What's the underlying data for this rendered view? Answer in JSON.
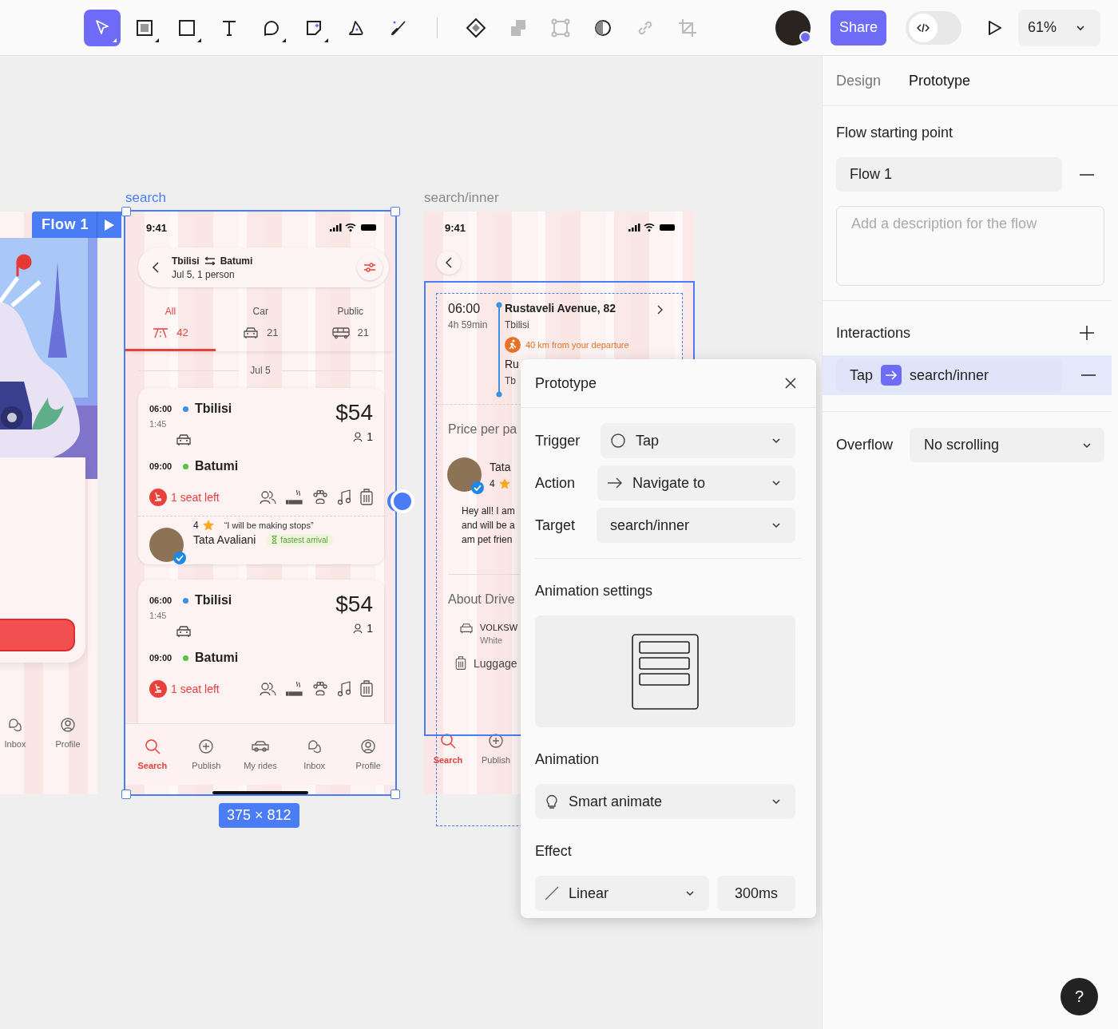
{
  "toolbar": {
    "tools": [
      {
        "kind": "move",
        "selected": true
      },
      {
        "kind": "frame",
        "selected": false
      },
      {
        "kind": "rectangle",
        "selected": false
      },
      {
        "kind": "text",
        "selected": false
      },
      {
        "kind": "comment",
        "selected": false
      },
      {
        "kind": "sticky",
        "selected": false
      },
      {
        "kind": "wizard",
        "selected": false
      },
      {
        "kind": "brush",
        "selected": false
      }
    ],
    "actions": [
      {
        "kind": "component",
        "disabled": false
      },
      {
        "kind": "boolean",
        "disabled": true
      },
      {
        "kind": "corners",
        "disabled": true
      },
      {
        "kind": "mask",
        "disabled": false
      },
      {
        "kind": "link",
        "disabled": true
      },
      {
        "kind": "crop",
        "disabled": true
      }
    ],
    "share": "Share",
    "dev_mode": false,
    "zoom": "61%"
  },
  "canvas": {
    "flow_badge": "Flow 1",
    "side_frame": {
      "nav": [
        {
          "label": "Inbox",
          "kind": "inbox",
          "selected": false
        },
        {
          "label": "Profile",
          "kind": "profile",
          "selected": false
        }
      ]
    },
    "search_frame": {
      "title": "search",
      "selected": true,
      "time": "9:41",
      "from": "Tbilisi",
      "to": "Batumi",
      "subtitle": "Jul 5, 1 person",
      "tabs": [
        {
          "label": "All",
          "count": "42",
          "kind": "all",
          "selected": true
        },
        {
          "label": "Car",
          "count": "21",
          "kind": "car",
          "selected": false
        },
        {
          "label": "Public",
          "count": "21",
          "kind": "bus",
          "selected": false
        }
      ],
      "date": "Jul 5",
      "rides": [
        {
          "dep_time": "06:00",
          "from": "Tbilisi",
          "duration": "1:45",
          "arr_time": "09:00",
          "to": "Batumi",
          "price": "$54",
          "seats": "1",
          "seat_note": "1 seat left",
          "review": {
            "rating": "4",
            "quote": "“I will be making stops”",
            "driver": "Tata Avaliani",
            "tag": "fastest arrival"
          }
        },
        {
          "dep_time": "06:00",
          "from": "Tbilisi",
          "duration": "1:45",
          "arr_time": "09:00",
          "to": "Batumi",
          "price": "$54",
          "seats": "1",
          "seat_note": "1 seat left"
        }
      ],
      "nav": [
        {
          "label": "Search",
          "kind": "search",
          "selected": true
        },
        {
          "label": "Publish",
          "kind": "publish",
          "selected": false
        },
        {
          "label": "My rides",
          "kind": "rides",
          "selected": false
        },
        {
          "label": "Inbox",
          "kind": "inbox",
          "selected": false
        },
        {
          "label": "Profile",
          "kind": "profile",
          "selected": false
        }
      ]
    },
    "inner_frame": {
      "title": "search/inner",
      "selected": false,
      "time": "9:41",
      "departure": "06:00",
      "duration": "4h 59min",
      "stop": "Rustaveli Avenue, 82",
      "city": "Tbilisi",
      "note": "40 km from your departure",
      "stop_2": "Ru",
      "city_2": "Tb",
      "price_label": "Price per pa",
      "driver": "Tata",
      "rating": "4",
      "bio": [
        "Hey all! I am",
        "and will be a",
        "am pet frien"
      ],
      "about": "About Drive",
      "car": "VOLKSW",
      "car_color": "White",
      "luggage": "Luggage",
      "nav": [
        {
          "label": "Search",
          "kind": "search",
          "selected": true
        },
        {
          "label": "Publish",
          "kind": "publish",
          "selected": false
        }
      ]
    },
    "dimensions": "375 × 812"
  },
  "prototype_popover": {
    "title": "Prototype",
    "rows": [
      {
        "label": "Trigger",
        "value": "Tap",
        "kind": "trigger"
      },
      {
        "label": "Action",
        "value": "Navigate to",
        "kind": "action"
      },
      {
        "label": "Target",
        "value": "search/inner",
        "kind": "target"
      }
    ],
    "settings_title": "Animation settings",
    "animation_label": "Animation",
    "animation": "Smart animate",
    "effect_label": "Effect",
    "effect": "Linear",
    "duration": "300ms"
  },
  "panel": {
    "tabs": [
      {
        "label": "Design",
        "selected": false
      },
      {
        "label": "Prototype",
        "selected": true
      }
    ],
    "flow_heading": "Flow starting point",
    "flow_name": "Flow 1",
    "description_placeholder": "Add a description for the flow",
    "interactions_heading": "Interactions",
    "interactions": [
      {
        "trigger": "Tap",
        "target": "search/inner",
        "selected": true
      }
    ],
    "overflow_label": "Overflow",
    "overflow": "No scrolling",
    "help": "?"
  }
}
